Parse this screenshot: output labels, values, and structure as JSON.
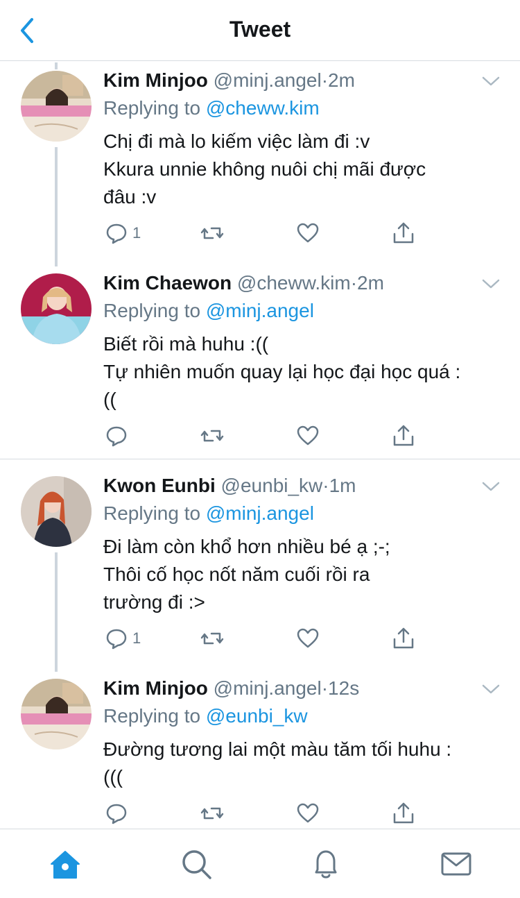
{
  "header": {
    "title": "Tweet",
    "back_icon": "chevron-left-icon"
  },
  "colors": {
    "accent": "#1b95e0",
    "text": "#14171a",
    "muted": "#657786",
    "divider": "#d6dbe0"
  },
  "tweets": [
    {
      "name": "Kim Minjoo",
      "handle": "@minj.angel",
      "dot": "·",
      "time": "2m",
      "replying_prefix": "Replying to",
      "replying_to": "@cheww.kim",
      "lines": [
        "Chị đi mà lo kiếm việc làm đi :v",
        "Kkura unnie không nuôi chị mãi được",
        "đâu :v"
      ],
      "reply_count": "1"
    },
    {
      "name": "Kim Chaewon",
      "handle": "@cheww.kim",
      "dot": "·",
      "time": "2m",
      "replying_prefix": "Replying to",
      "replying_to": "@minj.angel",
      "lines": [
        "Biết rồi mà huhu :((",
        "Tự nhiên muốn quay lại học đại học quá :",
        "(("
      ],
      "reply_count": ""
    },
    {
      "name": "Kwon Eunbi",
      "handle": "@eunbi_kw",
      "dot": "·",
      "time": "1m",
      "replying_prefix": "Replying to",
      "replying_to": "@minj.angel",
      "lines": [
        "Đi làm còn khổ hơn nhiều bé ạ ;-;",
        "Thôi cố học nốt năm cuối rồi ra",
        "trường đi :>"
      ],
      "reply_count": "1"
    },
    {
      "name": "Kim Minjoo",
      "handle": "@minj.angel",
      "dot": "·",
      "time": "12s",
      "replying_prefix": "Replying to",
      "replying_to": "@eunbi_kw",
      "lines": [
        "Đường tương lai một màu tăm tối huhu :",
        "((("
      ],
      "reply_count": ""
    }
  ],
  "action_icons": [
    "reply-icon",
    "retweet-icon",
    "like-icon",
    "share-icon"
  ],
  "tabbar": {
    "tabs": [
      {
        "name": "home",
        "icon": "home-icon",
        "active": true
      },
      {
        "name": "search",
        "icon": "search-icon",
        "active": false
      },
      {
        "name": "notifications",
        "icon": "bell-icon",
        "active": false
      },
      {
        "name": "messages",
        "icon": "mail-icon",
        "active": false
      }
    ]
  }
}
